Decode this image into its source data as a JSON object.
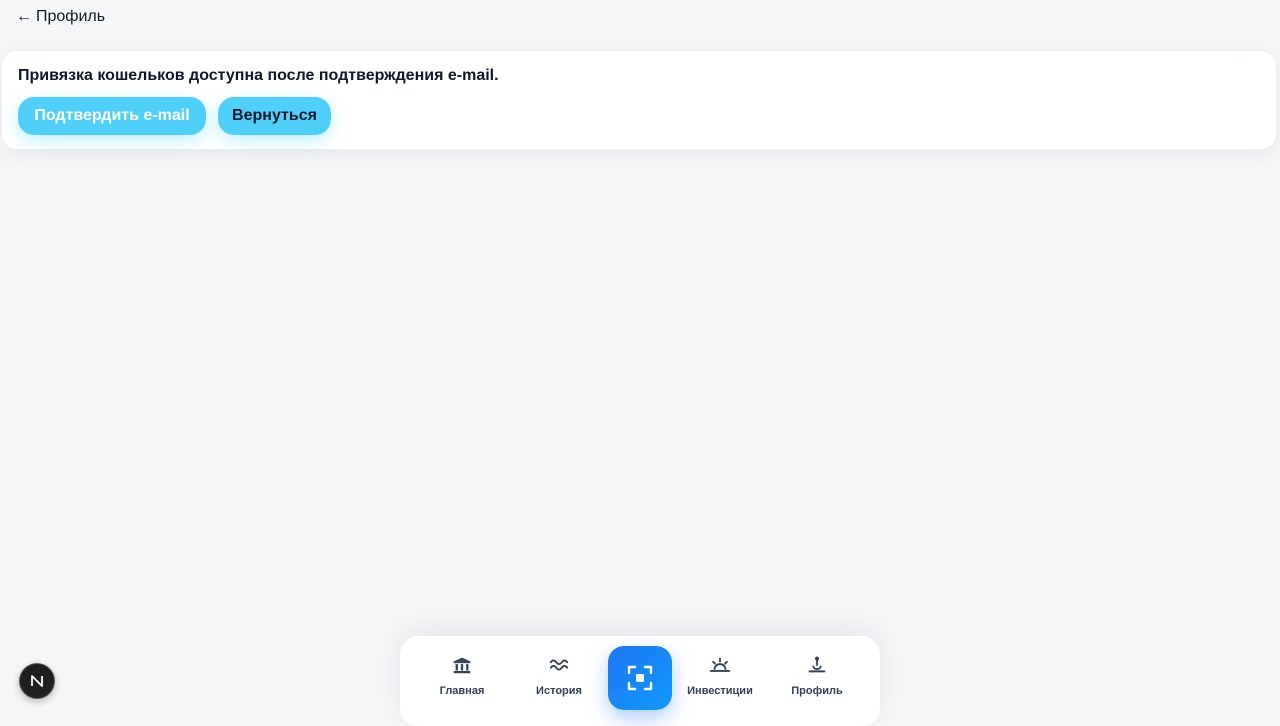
{
  "header": {
    "back_arrow": "←",
    "back_label": "Профиль"
  },
  "notice": {
    "message": "Привязка кошельков доступна после подтверждения e-mail.",
    "confirm_button": "Подтвердить e-mail",
    "back_button": "Вернуться"
  },
  "bottom_nav": {
    "items": [
      {
        "label": "Главная",
        "icon": "bank-icon"
      },
      {
        "label": "История",
        "icon": "waves-icon"
      },
      {
        "label": "Инвестиции",
        "icon": "sunrise-icon"
      },
      {
        "label": "Профиль",
        "icon": "profile-icon"
      }
    ],
    "center_icon": "scan-icon"
  },
  "dev_badge": {
    "icon": "next-logo-icon",
    "letter": "N"
  },
  "colors": {
    "accent": "#4fd0fb",
    "scan_gradient_start": "#1e74f5",
    "scan_gradient_end": "#0f9bf9",
    "background": "#f5f6f8",
    "text": "#0f172a"
  }
}
